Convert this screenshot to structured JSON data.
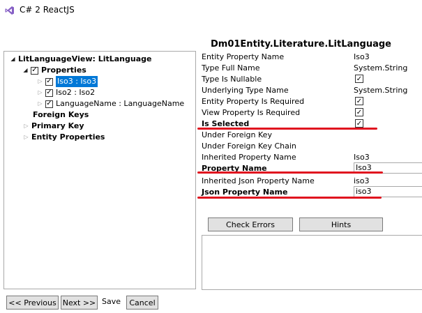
{
  "window": {
    "title": "C# 2 ReactJS"
  },
  "tree": {
    "root_label": "LitLanguageView: LitLanguage",
    "properties_label": "Properties",
    "items": [
      {
        "label": "Iso3 : Iso3",
        "checked": true,
        "selected": true
      },
      {
        "label": "Iso2 : Iso2",
        "checked": true,
        "selected": false
      },
      {
        "label": "LanguageName : LanguageName",
        "checked": true,
        "selected": false
      }
    ],
    "foreign_keys_label": "Foreign Keys",
    "primary_key_label": "Primary Key",
    "entity_properties_label": "Entity Properties"
  },
  "details": {
    "title": "Dm01Entity.Literature.LitLanguage",
    "rows": [
      {
        "label": "Entity Property Name",
        "value": "Iso3"
      },
      {
        "label": "Type Full Name",
        "value": "System.String"
      },
      {
        "label": "Type Is Nullable",
        "checked": true
      },
      {
        "label": "Underlying Type Name",
        "value": "System.String"
      },
      {
        "label": "Entity Property Is Required",
        "checked": true
      },
      {
        "label": "View Property Is Required",
        "checked": true
      },
      {
        "label": "Is Selected",
        "checked": true,
        "bold": true
      },
      {
        "label": "Under Foreign Key"
      },
      {
        "label": "Under Foreign Key Chain"
      },
      {
        "label": "Inherited Property Name",
        "value": "Iso3"
      },
      {
        "label": "Property Name",
        "input": "Iso3",
        "bold": true
      },
      {
        "label": "Inherited Json Property Name",
        "value": "iso3"
      },
      {
        "label": "Json Property Name",
        "input": "iso3",
        "bold": true
      }
    ]
  },
  "buttons": {
    "check_errors": "Check Errors",
    "hints": "Hints",
    "previous": "<< Previous",
    "next": "Next >>",
    "save": "Save",
    "cancel": "Cancel"
  },
  "colors": {
    "selection": "#0078d7",
    "annotation_underline": "#e0101e",
    "button_face": "#e1e1e1",
    "vs_logo": "#865fc5"
  },
  "icons": {
    "app_logo": "visual-studio-icon",
    "checkmark": "checkmark-icon",
    "expanded": "triangle-down-icon",
    "collapsed": "triangle-right-icon"
  }
}
